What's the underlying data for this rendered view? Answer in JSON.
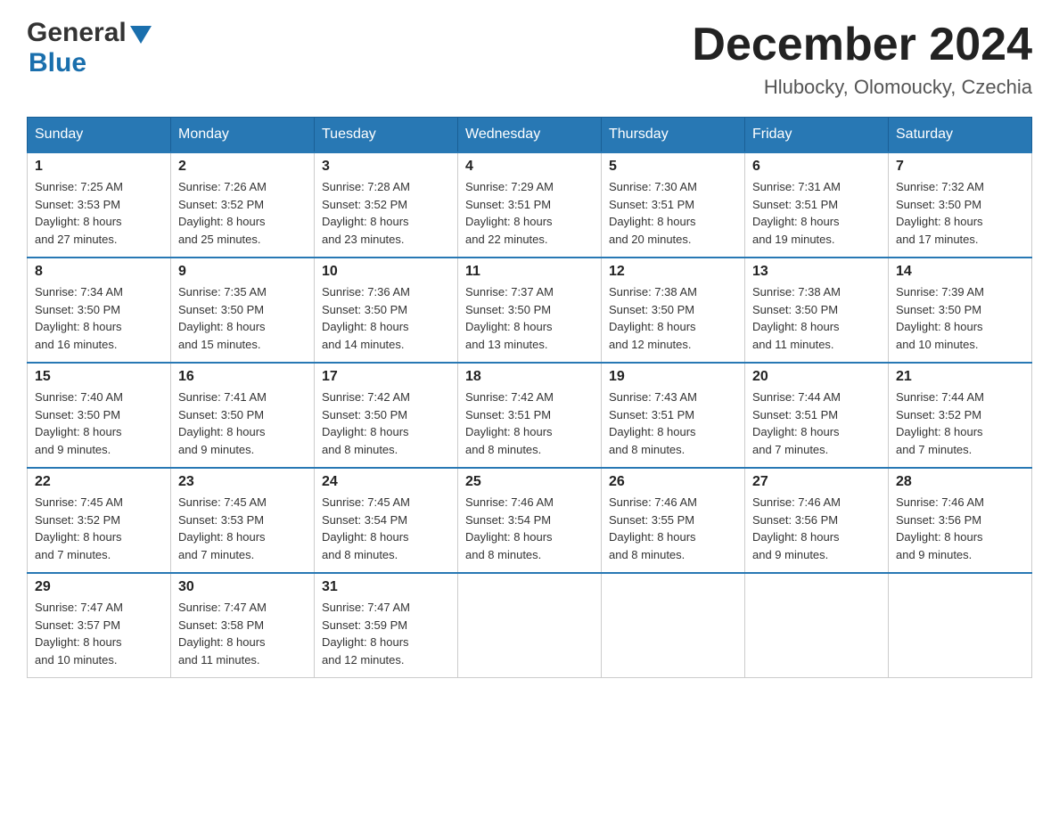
{
  "logo": {
    "general": "General",
    "blue": "Blue"
  },
  "title": "December 2024",
  "subtitle": "Hlubocky, Olomoucky, Czechia",
  "days_of_week": [
    "Sunday",
    "Monday",
    "Tuesday",
    "Wednesday",
    "Thursday",
    "Friday",
    "Saturday"
  ],
  "weeks": [
    [
      {
        "day": "1",
        "sunrise": "7:25 AM",
        "sunset": "3:53 PM",
        "daylight": "8 hours and 27 minutes."
      },
      {
        "day": "2",
        "sunrise": "7:26 AM",
        "sunset": "3:52 PM",
        "daylight": "8 hours and 25 minutes."
      },
      {
        "day": "3",
        "sunrise": "7:28 AM",
        "sunset": "3:52 PM",
        "daylight": "8 hours and 23 minutes."
      },
      {
        "day": "4",
        "sunrise": "7:29 AM",
        "sunset": "3:51 PM",
        "daylight": "8 hours and 22 minutes."
      },
      {
        "day": "5",
        "sunrise": "7:30 AM",
        "sunset": "3:51 PM",
        "daylight": "8 hours and 20 minutes."
      },
      {
        "day": "6",
        "sunrise": "7:31 AM",
        "sunset": "3:51 PM",
        "daylight": "8 hours and 19 minutes."
      },
      {
        "day": "7",
        "sunrise": "7:32 AM",
        "sunset": "3:50 PM",
        "daylight": "8 hours and 17 minutes."
      }
    ],
    [
      {
        "day": "8",
        "sunrise": "7:34 AM",
        "sunset": "3:50 PM",
        "daylight": "8 hours and 16 minutes."
      },
      {
        "day": "9",
        "sunrise": "7:35 AM",
        "sunset": "3:50 PM",
        "daylight": "8 hours and 15 minutes."
      },
      {
        "day": "10",
        "sunrise": "7:36 AM",
        "sunset": "3:50 PM",
        "daylight": "8 hours and 14 minutes."
      },
      {
        "day": "11",
        "sunrise": "7:37 AM",
        "sunset": "3:50 PM",
        "daylight": "8 hours and 13 minutes."
      },
      {
        "day": "12",
        "sunrise": "7:38 AM",
        "sunset": "3:50 PM",
        "daylight": "8 hours and 12 minutes."
      },
      {
        "day": "13",
        "sunrise": "7:38 AM",
        "sunset": "3:50 PM",
        "daylight": "8 hours and 11 minutes."
      },
      {
        "day": "14",
        "sunrise": "7:39 AM",
        "sunset": "3:50 PM",
        "daylight": "8 hours and 10 minutes."
      }
    ],
    [
      {
        "day": "15",
        "sunrise": "7:40 AM",
        "sunset": "3:50 PM",
        "daylight": "8 hours and 9 minutes."
      },
      {
        "day": "16",
        "sunrise": "7:41 AM",
        "sunset": "3:50 PM",
        "daylight": "8 hours and 9 minutes."
      },
      {
        "day": "17",
        "sunrise": "7:42 AM",
        "sunset": "3:50 PM",
        "daylight": "8 hours and 8 minutes."
      },
      {
        "day": "18",
        "sunrise": "7:42 AM",
        "sunset": "3:51 PM",
        "daylight": "8 hours and 8 minutes."
      },
      {
        "day": "19",
        "sunrise": "7:43 AM",
        "sunset": "3:51 PM",
        "daylight": "8 hours and 8 minutes."
      },
      {
        "day": "20",
        "sunrise": "7:44 AM",
        "sunset": "3:51 PM",
        "daylight": "8 hours and 7 minutes."
      },
      {
        "day": "21",
        "sunrise": "7:44 AM",
        "sunset": "3:52 PM",
        "daylight": "8 hours and 7 minutes."
      }
    ],
    [
      {
        "day": "22",
        "sunrise": "7:45 AM",
        "sunset": "3:52 PM",
        "daylight": "8 hours and 7 minutes."
      },
      {
        "day": "23",
        "sunrise": "7:45 AM",
        "sunset": "3:53 PM",
        "daylight": "8 hours and 7 minutes."
      },
      {
        "day": "24",
        "sunrise": "7:45 AM",
        "sunset": "3:54 PM",
        "daylight": "8 hours and 8 minutes."
      },
      {
        "day": "25",
        "sunrise": "7:46 AM",
        "sunset": "3:54 PM",
        "daylight": "8 hours and 8 minutes."
      },
      {
        "day": "26",
        "sunrise": "7:46 AM",
        "sunset": "3:55 PM",
        "daylight": "8 hours and 8 minutes."
      },
      {
        "day": "27",
        "sunrise": "7:46 AM",
        "sunset": "3:56 PM",
        "daylight": "8 hours and 9 minutes."
      },
      {
        "day": "28",
        "sunrise": "7:46 AM",
        "sunset": "3:56 PM",
        "daylight": "8 hours and 9 minutes."
      }
    ],
    [
      {
        "day": "29",
        "sunrise": "7:47 AM",
        "sunset": "3:57 PM",
        "daylight": "8 hours and 10 minutes."
      },
      {
        "day": "30",
        "sunrise": "7:47 AM",
        "sunset": "3:58 PM",
        "daylight": "8 hours and 11 minutes."
      },
      {
        "day": "31",
        "sunrise": "7:47 AM",
        "sunset": "3:59 PM",
        "daylight": "8 hours and 12 minutes."
      },
      null,
      null,
      null,
      null
    ]
  ],
  "labels": {
    "sunrise": "Sunrise:",
    "sunset": "Sunset:",
    "daylight": "Daylight:"
  }
}
